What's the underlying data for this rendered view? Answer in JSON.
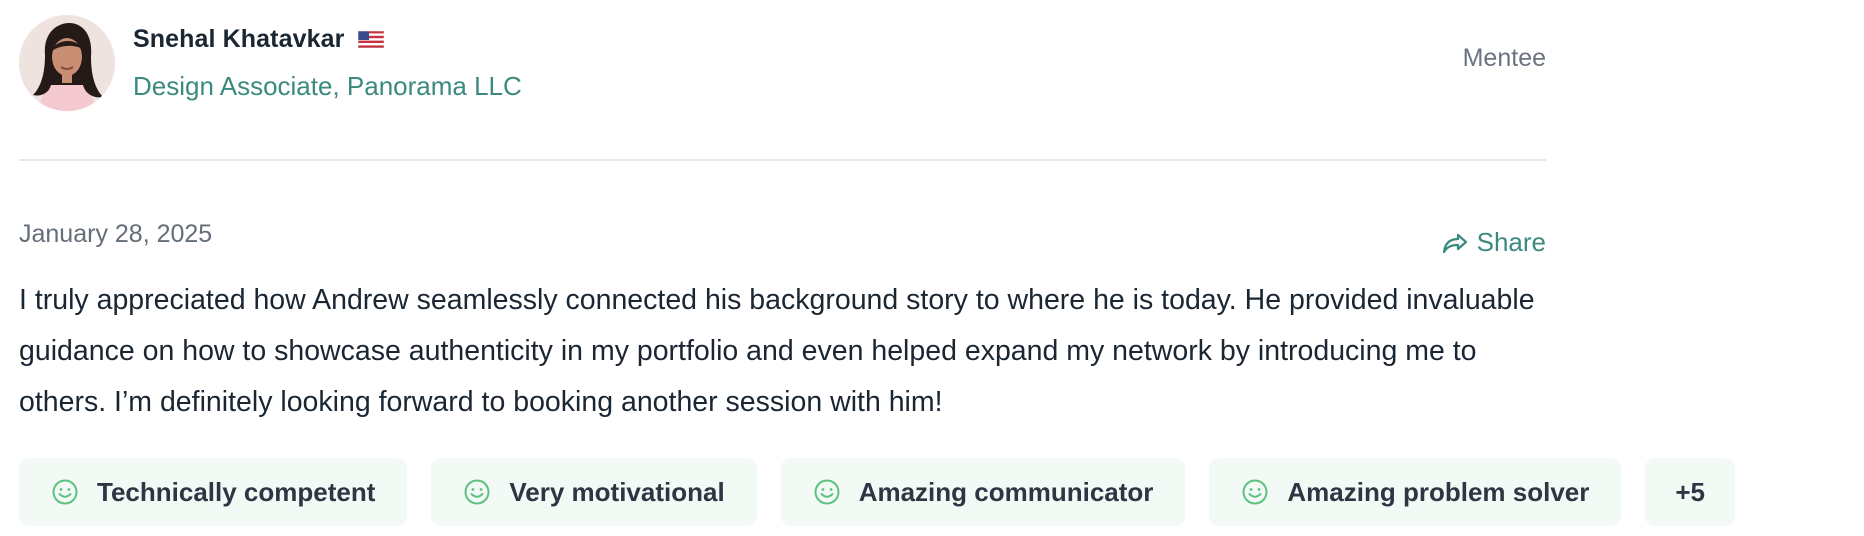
{
  "reviewer": {
    "name": "Snehal Khatavkar",
    "flag_icon": "us-flag-icon",
    "role": "Design Associate, Panorama LLC",
    "badge": "Mentee"
  },
  "review": {
    "date": "January 28, 2025",
    "share_label": "Share",
    "share_icon": "share-arrow-icon",
    "text": "I truly appreciated how Andrew seamlessly connected his background story to where he is today. He provided invaluable guidance on how to showcase authenticity in my portfolio and even helped expand my network by introducing me to others. I’m definitely looking forward to booking another session with him!"
  },
  "tags": [
    {
      "label": "Technically competent",
      "icon": "smile-icon"
    },
    {
      "label": "Very motivational",
      "icon": "smile-icon"
    },
    {
      "label": "Amazing communicator",
      "icon": "smile-icon"
    },
    {
      "label": "Amazing problem solver",
      "icon": "smile-icon"
    }
  ],
  "more_tags_label": "+5",
  "colors": {
    "accent": "#3b8a7f",
    "tag_background": "#f3faf6",
    "smile_icon": "#5cc27f",
    "text": "#1b2633",
    "muted": "#646d78"
  }
}
